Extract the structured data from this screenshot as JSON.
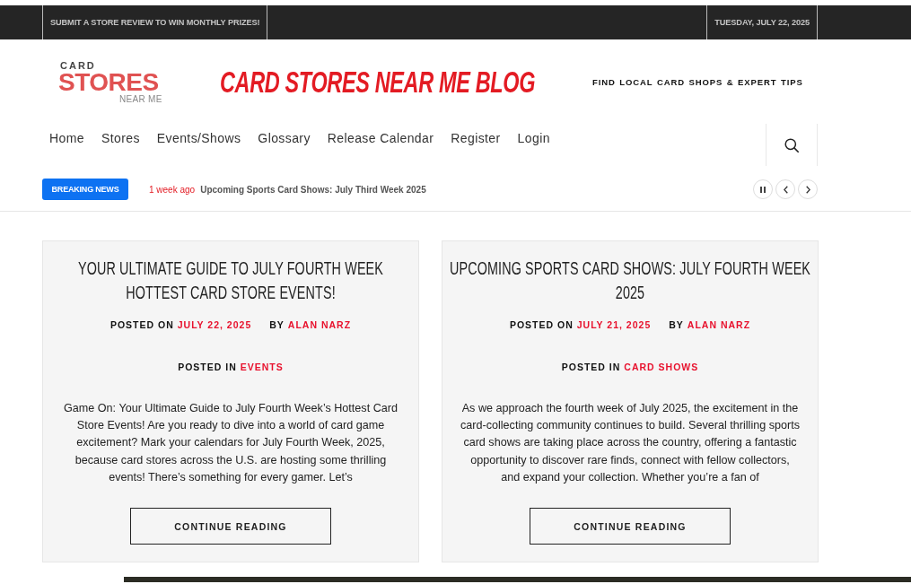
{
  "top_bar": {
    "announcement": "SUBMIT A STORE REVIEW TO WIN MONTHLY PRIZES!",
    "date": "TUESDAY, JULY 22, 2025"
  },
  "header": {
    "logo": {
      "top": "CARD",
      "middle": "STORES",
      "bottom": "NEAR ME"
    },
    "site_title": "CARD STORES NEAR ME BLOG",
    "tagline": "FIND LOCAL CARD SHOPS & EXPERT TIPS"
  },
  "nav": {
    "items": [
      "Home",
      "Stores",
      "Events/Shows",
      "Glossary",
      "Release Calendar",
      "Register",
      "Login"
    ]
  },
  "breaking_news": {
    "label": "BREAKING NEWS",
    "time": "1 week ago",
    "headline": "Upcoming Sports Card Shows: July Third Week 2025"
  },
  "posts": [
    {
      "title": "YOUR ULTIMATE GUIDE TO JULY FOURTH WEEK HOTTEST CARD STORE EVENTS!",
      "posted_on_label": "POSTED ON",
      "date": "JULY 22, 2025",
      "by_label": "BY",
      "author": "ALAN NARZ",
      "posted_in_label": "POSTED IN",
      "category": "EVENTS",
      "excerpt": "Game On: Your Ultimate Guide to July Fourth Week’s Hottest Card Store Events! Are you ready to dive into a world of card game excitement? Mark your calendars for July Fourth Week, 2025, because card stores across the U.S. are hosting some thrilling events! There’s something for every gamer. Let’s",
      "button": "CONTINUE READING"
    },
    {
      "title": "UPCOMING SPORTS CARD SHOWS: JULY FOURTH WEEK 2025",
      "posted_on_label": "POSTED ON",
      "date": "JULY 21, 2025",
      "by_label": "BY",
      "author": "ALAN NARZ",
      "posted_in_label": "POSTED IN",
      "category": "CARD SHOWS",
      "excerpt": "As we approach the fourth week of July 2025, the excitement in the card-collecting community continues to build. Several thrilling sports card shows are taking place across the country, offering a fantastic opportunity to discover rare finds, connect with fellow collectors, and expand your collection. Whether you’re a fan of",
      "button": "CONTINUE READING"
    }
  ]
}
